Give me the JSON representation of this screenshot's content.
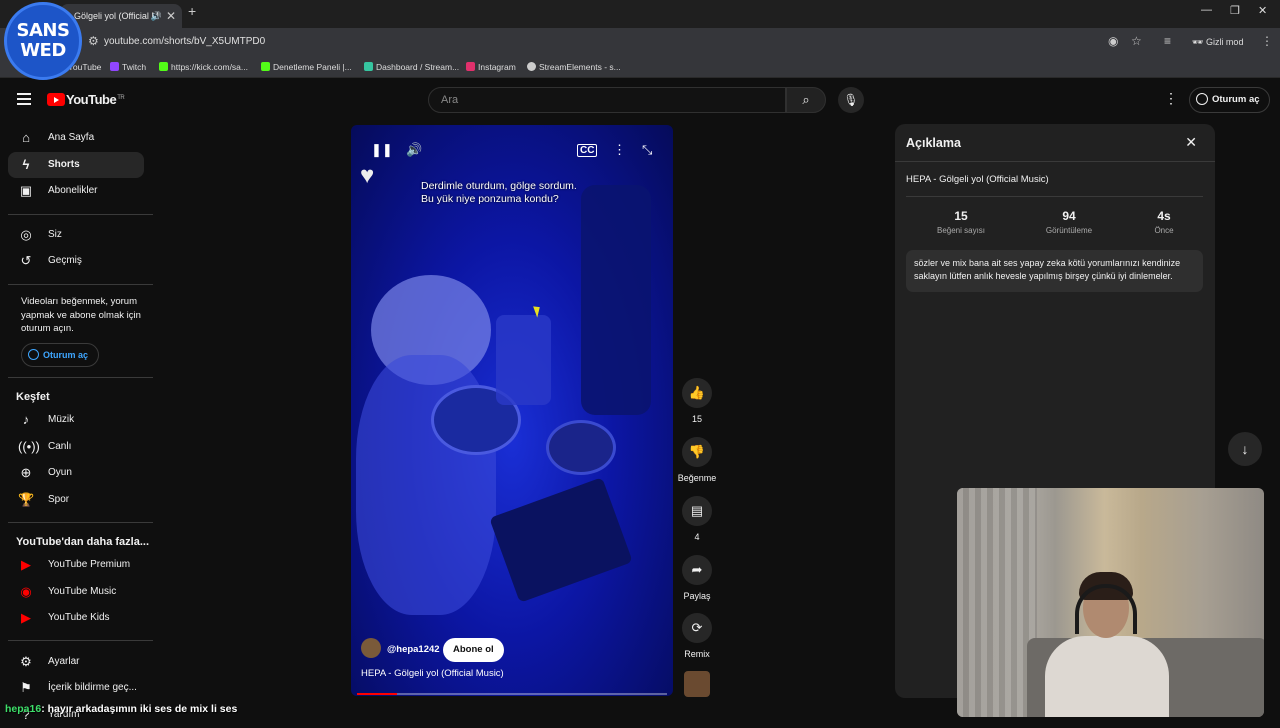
{
  "browser": {
    "tab_title": "Gölgeli yol (Official M",
    "url": "youtube.com/shorts/bV_X5UMTPD0",
    "incognito_label": "Gizli mod",
    "bookmarks": [
      {
        "label": "YouTube",
        "color": "#ff0000"
      },
      {
        "label": "Twitch",
        "color": "#9146ff"
      },
      {
        "label": "https://kick.com/sa...",
        "color": "#53fc18"
      },
      {
        "label": "Denetleme Paneli |...",
        "color": "#53fc18"
      },
      {
        "label": "Dashboard / Stream...",
        "color": "#36c5a0"
      },
      {
        "label": "Instagram",
        "color": "#e1306c"
      },
      {
        "label": "StreamElements - s...",
        "color": "#cccccc"
      }
    ]
  },
  "overlay_logo": {
    "line1": "SANS",
    "line2": "WED"
  },
  "header": {
    "logo_text": "YouTube",
    "region": "TR",
    "search_placeholder": "Ara",
    "signin_label": "Oturum aç"
  },
  "sidebar": {
    "primary": [
      {
        "label": "Ana Sayfa",
        "icon": "home-icon"
      },
      {
        "label": "Shorts",
        "icon": "shorts-icon"
      },
      {
        "label": "Abonelikler",
        "icon": "subscriptions-icon"
      }
    ],
    "you": [
      {
        "label": "Siz",
        "icon": "you-icon"
      },
      {
        "label": "Geçmiş",
        "icon": "history-icon"
      }
    ],
    "promo_text": "Videoları beğenmek, yorum yapmak ve abone olmak için oturum açın.",
    "promo_button": "Oturum aç",
    "explore_title": "Keşfet",
    "explore": [
      {
        "label": "Müzik",
        "icon": "music-icon"
      },
      {
        "label": "Canlı",
        "icon": "live-icon"
      },
      {
        "label": "Oyun",
        "icon": "gaming-icon"
      },
      {
        "label": "Spor",
        "icon": "sports-icon"
      }
    ],
    "more_title": "YouTube'dan daha fazla...",
    "more": [
      {
        "label": "YouTube Premium",
        "icon": "youtube-premium-icon"
      },
      {
        "label": "YouTube Music",
        "icon": "youtube-music-icon"
      },
      {
        "label": "YouTube Kids",
        "icon": "youtube-kids-icon"
      }
    ],
    "settings": [
      {
        "label": "Ayarlar",
        "icon": "settings-icon"
      },
      {
        "label": "İçerik bildirme geç...",
        "icon": "flag-icon"
      },
      {
        "label": "Yardım",
        "icon": "help-icon"
      }
    ]
  },
  "video": {
    "caption_line1": "Derdimle oturdum, gölge sordum.",
    "caption_line2": "Bu yük niye ponzuma kondu?",
    "channel": "@hepa1242",
    "subscribe_label": "Abone ol",
    "title": "HEPA - Gölgeli yol (Official Music)",
    "progress": 0.13
  },
  "actions": {
    "likes": "15",
    "dislike_label": "Beğenme",
    "comments": "4",
    "share_label": "Paylaş",
    "remix_label": "Remix"
  },
  "description": {
    "heading": "Açıklama",
    "title": "HEPA - Gölgeli yol (Official Music)",
    "stats": [
      {
        "value": "15",
        "label": "Beğeni sayısı"
      },
      {
        "value": "94",
        "label": "Görüntüleme"
      },
      {
        "value": "4s",
        "label": "Önce"
      }
    ],
    "body": "sözler ve mix bana ait ses yapay zeka kötü yorumlarınızı kendinize saklayın lütfen anlık hevesle yapılmış birşey çünkü iyi dinlemeler."
  },
  "chat": {
    "user": "hepa16",
    "message": ": hayır arkadaşımın iki ses de mix li ses"
  }
}
